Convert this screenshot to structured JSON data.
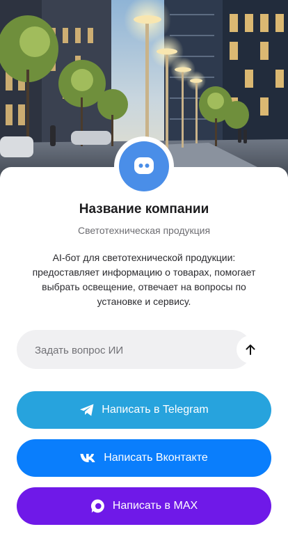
{
  "company": {
    "title": "Название компании",
    "subtitle": "Светотехническая продукция",
    "description": "AI-бот для светотехнической продукции: предоставляет информацию о товарах, помогает выбрать освещение, отвечает на вопросы по установке и сервису."
  },
  "avatar": {
    "icon": "chat-bubble-icon",
    "color": "#4a8ee8"
  },
  "ask": {
    "placeholder": "Задать вопрос ИИ",
    "value": "",
    "send_icon": "arrow-up-icon"
  },
  "buttons": [
    {
      "label": "Написать в Telegram",
      "icon": "telegram-icon",
      "color": "#27a3dd"
    },
    {
      "label": "Написать Вконтакте",
      "icon": "vk-icon",
      "color": "#0a7efc"
    },
    {
      "label": "Написать в MAX",
      "icon": "max-icon",
      "color": "#6f19e8"
    }
  ]
}
